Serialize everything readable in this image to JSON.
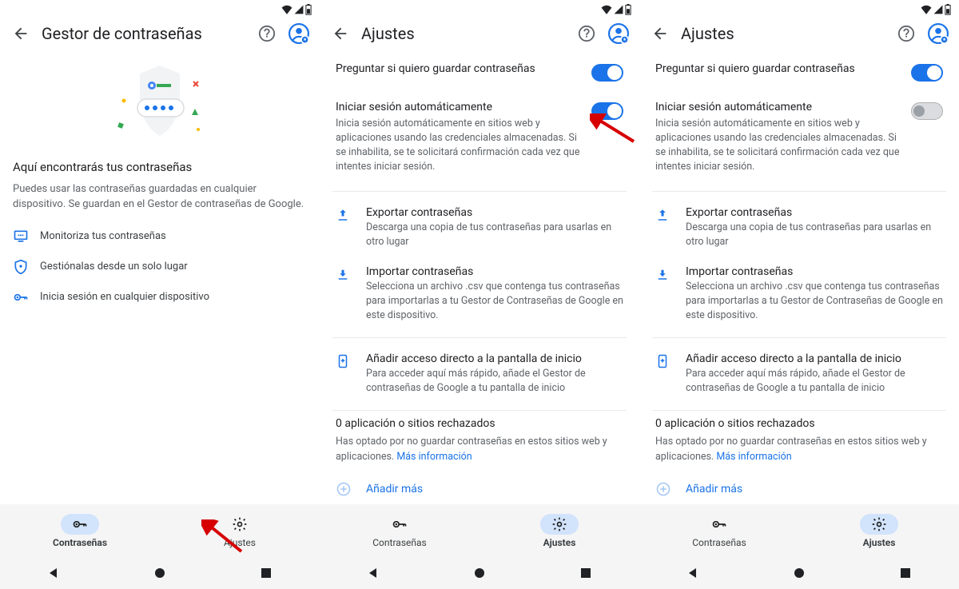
{
  "screen1": {
    "title": "Gestor de contraseñas",
    "heading": "Aquí encontrarás tus contraseñas",
    "subtitle": "Puedes usar las contraseñas guardadas en cualquier dispositivo. Se guardan en el Gestor de contraseñas de Google.",
    "features": [
      "Monitoriza tus contraseñas",
      "Gestiónalas desde un solo lugar",
      "Inicia sesión en cualquier dispositivo"
    ],
    "nav": {
      "passwords": "Contraseñas",
      "settings": "Ajustes"
    }
  },
  "settings": {
    "title": "Ajustes",
    "askSave": {
      "title": "Preguntar si quiero guardar contraseñas"
    },
    "autoSignin": {
      "title": "Iniciar sesión automáticamente",
      "desc": "Inicia sesión automáticamente en sitios web y aplicaciones usando las credenciales almacenadas. Si se inhabilita, se te solicitará confirmación cada vez que intentes iniciar sesión."
    },
    "export": {
      "title": "Exportar contraseñas",
      "desc": "Descarga una copia de tus contraseñas para usarlas en otro lugar"
    },
    "import": {
      "title": "Importar contraseñas",
      "desc": "Selecciona un archivo .csv que contenga tus contraseñas para importarlas a tu Gestor de Contraseñas de Google en este dispositivo."
    },
    "shortcut": {
      "title": "Añadir acceso directo a la pantalla de inicio",
      "desc": "Para acceder aquí más rápido, añade el Gestor de contraseñas de Google a tu pantalla de inicio"
    },
    "rejected": {
      "title": "0 aplicación o sitios rechazados",
      "desc": "Has optado por no guardar contraseñas en estos sitios web y aplicaciones. ",
      "link": "Más información"
    },
    "addMore": "Añadir más",
    "nav": {
      "passwords": "Contraseñas",
      "settings": "Ajustes"
    }
  }
}
